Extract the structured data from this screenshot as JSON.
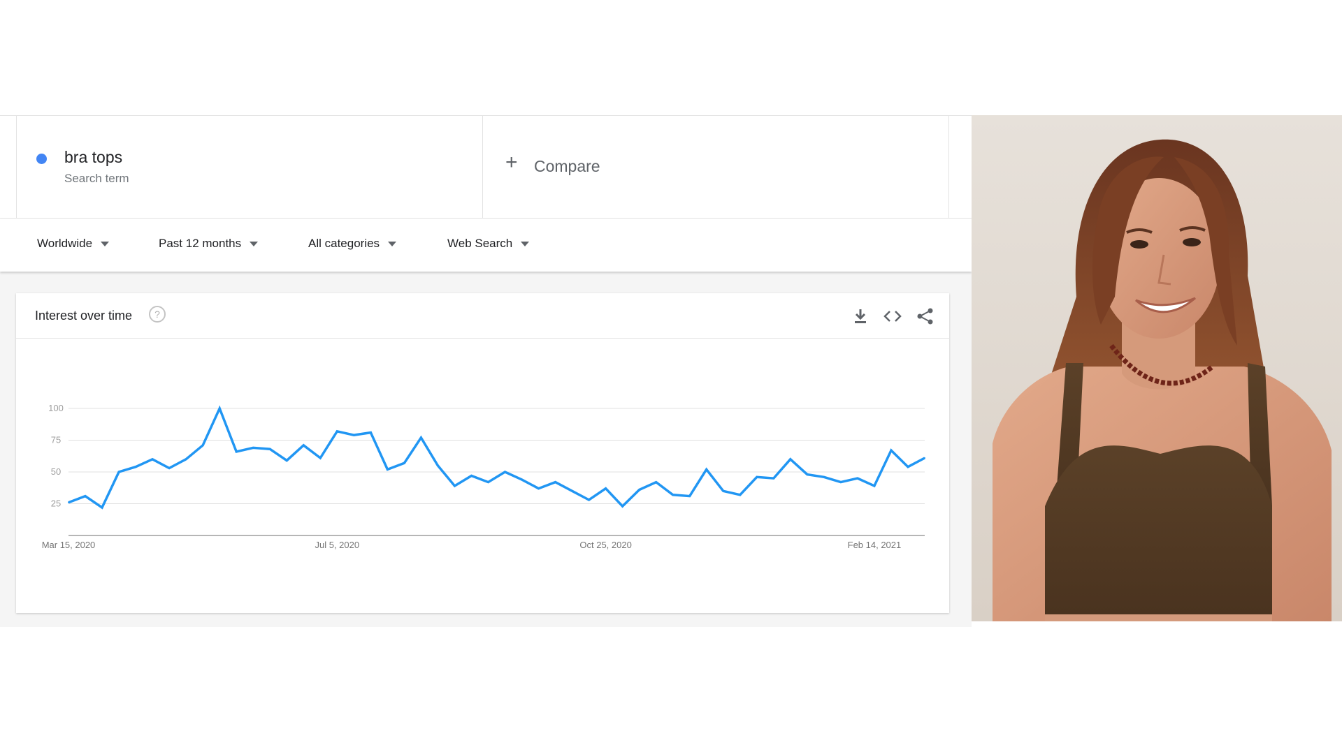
{
  "search_term": {
    "name": "bra tops",
    "label": "Search term",
    "color": "#4285f4"
  },
  "compare": {
    "label": "Compare"
  },
  "filters": [
    {
      "label": "Worldwide"
    },
    {
      "label": "Past 12 months"
    },
    {
      "label": "All categories"
    },
    {
      "label": "Web Search"
    }
  ],
  "panel": {
    "title": "Interest over time",
    "icons": [
      "help-icon",
      "download-icon",
      "embed-code-icon",
      "share-icon"
    ]
  },
  "chart_data": {
    "type": "line",
    "series": [
      {
        "name": "bra tops",
        "color": "#2196f3",
        "values": [
          26,
          31,
          22,
          50,
          54,
          60,
          53,
          60,
          71,
          100,
          66,
          69,
          68,
          59,
          71,
          61,
          82,
          79,
          81,
          52,
          57,
          77,
          55,
          39,
          47,
          42,
          50,
          44,
          37,
          42,
          35,
          28,
          37,
          23,
          36,
          42,
          32,
          31,
          52,
          35,
          32,
          46,
          45,
          60,
          48,
          46,
          42,
          45,
          39,
          67,
          54,
          61
        ]
      }
    ],
    "x_tick_labels": [
      "Mar 15, 2020",
      "Jul 5, 2020",
      "Oct 25, 2020",
      "Feb 14, 2021"
    ],
    "x_tick_index": [
      0,
      16,
      32,
      48
    ],
    "yticks": [
      25,
      50,
      75,
      100
    ],
    "ylim": [
      0,
      100
    ],
    "grid": true
  },
  "photo": {
    "description_icon": "model-photo"
  }
}
